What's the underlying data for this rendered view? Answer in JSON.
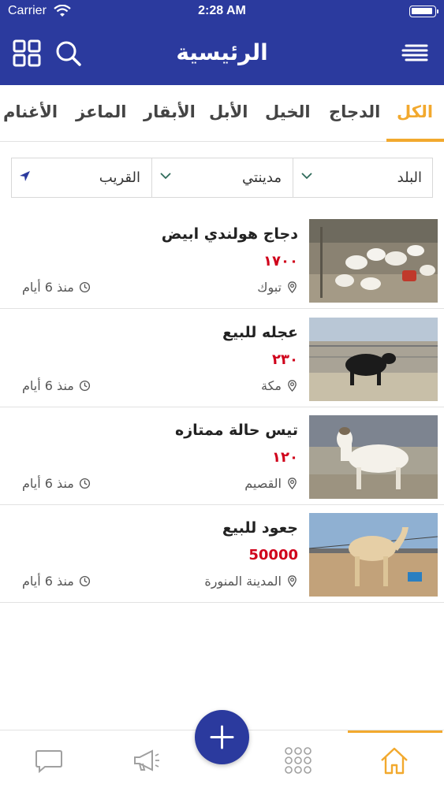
{
  "status_bar": {
    "carrier": "Carrier",
    "time": "2:28 AM"
  },
  "header": {
    "title": "الرئيسية",
    "grid_icon": "grid-icon",
    "search_icon": "search-icon",
    "menu_icon": "menu-icon"
  },
  "tabs": [
    {
      "label": "الكل",
      "active": true
    },
    {
      "label": "الدجاج",
      "active": false
    },
    {
      "label": "الخيل",
      "active": false
    },
    {
      "label": "الأبل",
      "active": false
    },
    {
      "label": "الأبقار",
      "active": false
    },
    {
      "label": "الماعز",
      "active": false
    },
    {
      "label": "الأغنام",
      "active": false
    }
  ],
  "filters": {
    "country": "البلد",
    "city": "مدينتي",
    "nearby": "القريب"
  },
  "listings": [
    {
      "title": "دجاج هولندي ابيض",
      "price": "١٧٠٠",
      "location": "تبوك",
      "time": "منذ 6 أيام",
      "image": "white chickens in a coop"
    },
    {
      "title": "عجله للبيع",
      "price": "٢٣٠",
      "location": "مكة",
      "time": "منذ 6 أيام",
      "image": "black calf in a pen"
    },
    {
      "title": "تيس حالة ممتازه",
      "price": "١٢٠",
      "location": "القصيم",
      "time": "منذ 6 أيام",
      "image": "white goat"
    },
    {
      "title": "جعود للبيع",
      "price": "50000",
      "location": "المدينة المنورة",
      "time": "منذ 6 أيام",
      "image": "camel in a pen"
    }
  ],
  "bottom_nav": [
    {
      "name": "chat-icon"
    },
    {
      "name": "megaphone-icon"
    },
    {
      "name": "add-icon"
    },
    {
      "name": "categories-grid-icon"
    },
    {
      "name": "home-icon"
    }
  ],
  "colors": {
    "primary": "#2b3a9e",
    "accent": "#f2a92e",
    "price": "#d0021b"
  }
}
